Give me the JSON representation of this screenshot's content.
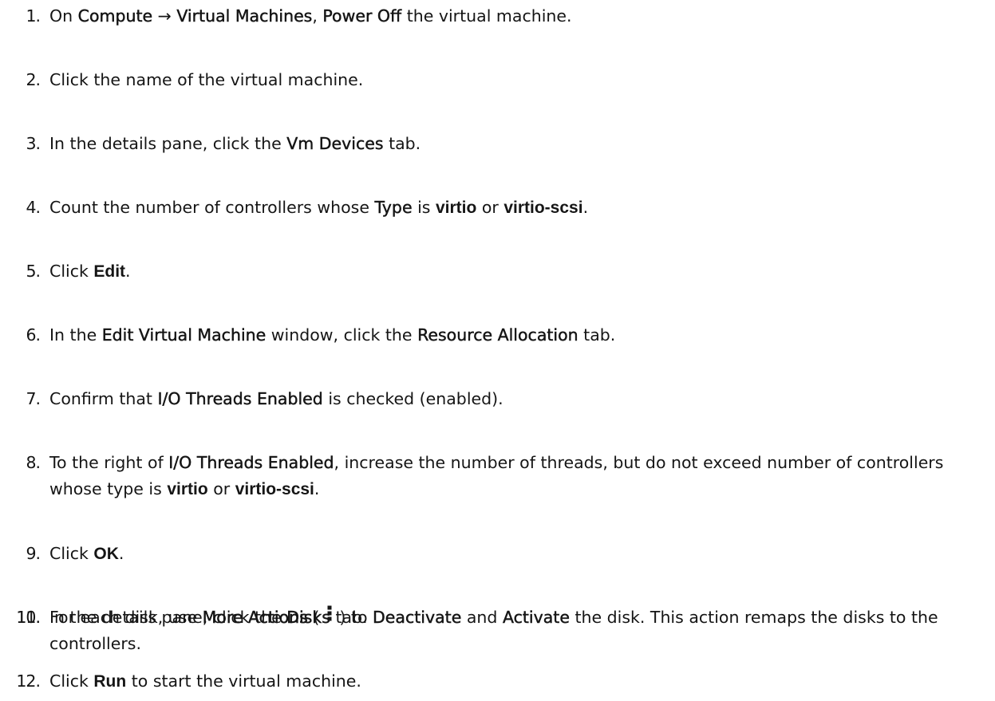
{
  "steps": [
    {
      "num": "1.",
      "parts": [
        {
          "t": "On ",
          "s": "text"
        },
        {
          "t": "Compute",
          "s": "ui"
        },
        {
          "t": " → ",
          "s": "text"
        },
        {
          "t": "Virtual Machines",
          "s": "ui"
        },
        {
          "t": ", ",
          "s": "text"
        },
        {
          "t": "Power Off",
          "s": "ui"
        },
        {
          "t": " the virtual machine.",
          "s": "text"
        }
      ]
    },
    {
      "num": "2.",
      "parts": [
        {
          "t": "Click the name of the virtual machine.",
          "s": "text"
        }
      ]
    },
    {
      "num": "3.",
      "parts": [
        {
          "t": "In the details pane, click the ",
          "s": "text"
        },
        {
          "t": "Vm Devices",
          "s": "ui"
        },
        {
          "t": " tab.",
          "s": "text"
        }
      ]
    },
    {
      "num": "4.",
      "parts": [
        {
          "t": "Count the number of controllers whose ",
          "s": "text"
        },
        {
          "t": "Type",
          "s": "ui"
        },
        {
          "t": " is ",
          "s": "text"
        },
        {
          "t": "virtio",
          "s": "cmd"
        },
        {
          "t": " or ",
          "s": "text"
        },
        {
          "t": "virtio-scsi",
          "s": "cmd"
        },
        {
          "t": ".",
          "s": "text"
        }
      ]
    },
    {
      "num": "5.",
      "parts": [
        {
          "t": "Click ",
          "s": "text"
        },
        {
          "t": "Edit",
          "s": "cmd"
        },
        {
          "t": ".",
          "s": "text"
        }
      ]
    },
    {
      "num": "6.",
      "parts": [
        {
          "t": "In the ",
          "s": "text"
        },
        {
          "t": "Edit Virtual Machine",
          "s": "ui"
        },
        {
          "t": " window, click the ",
          "s": "text"
        },
        {
          "t": "Resource Allocation",
          "s": "ui"
        },
        {
          "t": " tab.",
          "s": "text"
        }
      ]
    },
    {
      "num": "7.",
      "parts": [
        {
          "t": "Confirm that ",
          "s": "text"
        },
        {
          "t": "I/O Threads Enabled",
          "s": "ui"
        },
        {
          "t": " is checked (enabled).",
          "s": "text"
        }
      ]
    },
    {
      "num": "8.",
      "parts": [
        {
          "t": "To the right of ",
          "s": "text"
        },
        {
          "t": "I/O Threads Enabled",
          "s": "ui"
        },
        {
          "t": ", increase the number of threads, but do not exceed number of controllers whose type is ",
          "s": "text"
        },
        {
          "t": "virtio",
          "s": "cmd"
        },
        {
          "t": " or ",
          "s": "text"
        },
        {
          "t": "virtio-scsi",
          "s": "cmd"
        },
        {
          "t": ".",
          "s": "text"
        }
      ]
    },
    {
      "num": "9.",
      "parts": [
        {
          "t": "Click ",
          "s": "text"
        },
        {
          "t": "OK",
          "s": "cmd"
        },
        {
          "t": ".",
          "s": "text"
        }
      ]
    },
    {
      "num": "10.",
      "parts": [
        {
          "t": "In the details pane, click the ",
          "s": "text"
        },
        {
          "t": "Disks",
          "s": "ui"
        },
        {
          "t": " tab.",
          "s": "text"
        }
      ]
    },
    {
      "num": "11.",
      "parts": [
        {
          "t": "For each disk, use ",
          "s": "text"
        },
        {
          "t": "More Actions",
          "s": "ui"
        },
        {
          "t": " ( ",
          "s": "text"
        },
        {
          "t": "kebab-icon",
          "s": "icon"
        },
        {
          "t": " ) to ",
          "s": "text"
        },
        {
          "t": "Deactivate",
          "s": "ui"
        },
        {
          "t": " and ",
          "s": "text"
        },
        {
          "t": "Activate",
          "s": "ui"
        },
        {
          "t": " the disk. This action remaps the disks to the controllers.",
          "s": "text"
        }
      ]
    },
    {
      "num": "12.",
      "parts": [
        {
          "t": "Click ",
          "s": "text"
        },
        {
          "t": "Run",
          "s": "cmd"
        },
        {
          "t": " to start the virtual machine.",
          "s": "text"
        }
      ]
    }
  ]
}
